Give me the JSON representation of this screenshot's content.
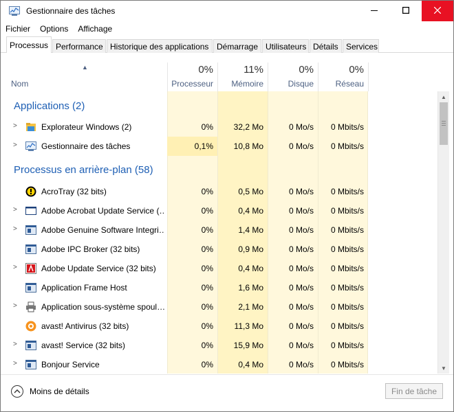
{
  "window": {
    "title": "Gestionnaire des tâches",
    "controls": {
      "minimize": "minimize-icon",
      "maximize": "maximize-icon",
      "close": "close-icon"
    }
  },
  "menu": [
    "Fichier",
    "Options",
    "Affichage"
  ],
  "tabs": [
    {
      "label": "Processus",
      "active": true
    },
    {
      "label": "Performance"
    },
    {
      "label": "Historique des applications"
    },
    {
      "label": "Démarrage"
    },
    {
      "label": "Utilisateurs"
    },
    {
      "label": "Détails"
    },
    {
      "label": "Services"
    }
  ],
  "columns": {
    "name": "Nom",
    "cpu": {
      "pct": "0%",
      "label": "Processeur"
    },
    "memory": {
      "pct": "11%",
      "label": "Mémoire"
    },
    "disk": {
      "pct": "0%",
      "label": "Disque"
    },
    "network": {
      "pct": "0%",
      "label": "Réseau"
    }
  },
  "groups": {
    "apps": "Applications (2)",
    "background": "Processus en arrière-plan (58)"
  },
  "apps": [
    {
      "name": "Explorateur Windows (2)",
      "icon": "folder-icon",
      "cpu": "0%",
      "mem": "32,2 Mo",
      "disk": "0 Mo/s",
      "net": "0 Mbits/s",
      "expandable": true
    },
    {
      "name": "Gestionnaire des tâches",
      "icon": "task-manager-icon",
      "cpu": "0,1%",
      "mem": "10,8 Mo",
      "disk": "0 Mo/s",
      "net": "0 Mbits/s",
      "expandable": true
    }
  ],
  "background": [
    {
      "name": "AcroTray (32 bits)",
      "icon": "acrotray-icon",
      "cpu": "0%",
      "mem": "0,5 Mo",
      "disk": "0 Mo/s",
      "net": "0 Mbits/s",
      "expandable": false
    },
    {
      "name": "Adobe Acrobat Update Service (…",
      "icon": "window-app-icon",
      "cpu": "0%",
      "mem": "0,4 Mo",
      "disk": "0 Mo/s",
      "net": "0 Mbits/s",
      "expandable": true
    },
    {
      "name": "Adobe Genuine Software Integri…",
      "icon": "service-icon",
      "cpu": "0%",
      "mem": "1,4 Mo",
      "disk": "0 Mo/s",
      "net": "0 Mbits/s",
      "expandable": true
    },
    {
      "name": "Adobe IPC Broker (32 bits)",
      "icon": "service-icon",
      "cpu": "0%",
      "mem": "0,9 Mo",
      "disk": "0 Mo/s",
      "net": "0 Mbits/s",
      "expandable": false
    },
    {
      "name": "Adobe Update Service (32 bits)",
      "icon": "adobe-icon",
      "cpu": "0%",
      "mem": "0,4 Mo",
      "disk": "0 Mo/s",
      "net": "0 Mbits/s",
      "expandable": true
    },
    {
      "name": "Application Frame Host",
      "icon": "service-icon",
      "cpu": "0%",
      "mem": "1,6 Mo",
      "disk": "0 Mo/s",
      "net": "0 Mbits/s",
      "expandable": false
    },
    {
      "name": "Application sous-système spoul…",
      "icon": "printer-icon",
      "cpu": "0%",
      "mem": "2,1 Mo",
      "disk": "0 Mo/s",
      "net": "0 Mbits/s",
      "expandable": true
    },
    {
      "name": "avast! Antivirus (32 bits)",
      "icon": "avast-icon",
      "cpu": "0%",
      "mem": "11,3 Mo",
      "disk": "0 Mo/s",
      "net": "0 Mbits/s",
      "expandable": false
    },
    {
      "name": "avast! Service (32 bits)",
      "icon": "service-icon",
      "cpu": "0%",
      "mem": "15,9 Mo",
      "disk": "0 Mo/s",
      "net": "0 Mbits/s",
      "expandable": true
    },
    {
      "name": "Bonjour Service",
      "icon": "service-icon",
      "cpu": "0%",
      "mem": "0,4 Mo",
      "disk": "0 Mo/s",
      "net": "0 Mbits/s",
      "expandable": true
    }
  ],
  "footer": {
    "less_details": "Moins de détails",
    "end_task": "Fin de tâche"
  },
  "colors": {
    "group_title": "#1e5fb4",
    "heat_light": "#fff8dc",
    "heat_medium": "#fff0b4",
    "heat_strong": "#f9eca8",
    "close_button": "#e81123"
  }
}
